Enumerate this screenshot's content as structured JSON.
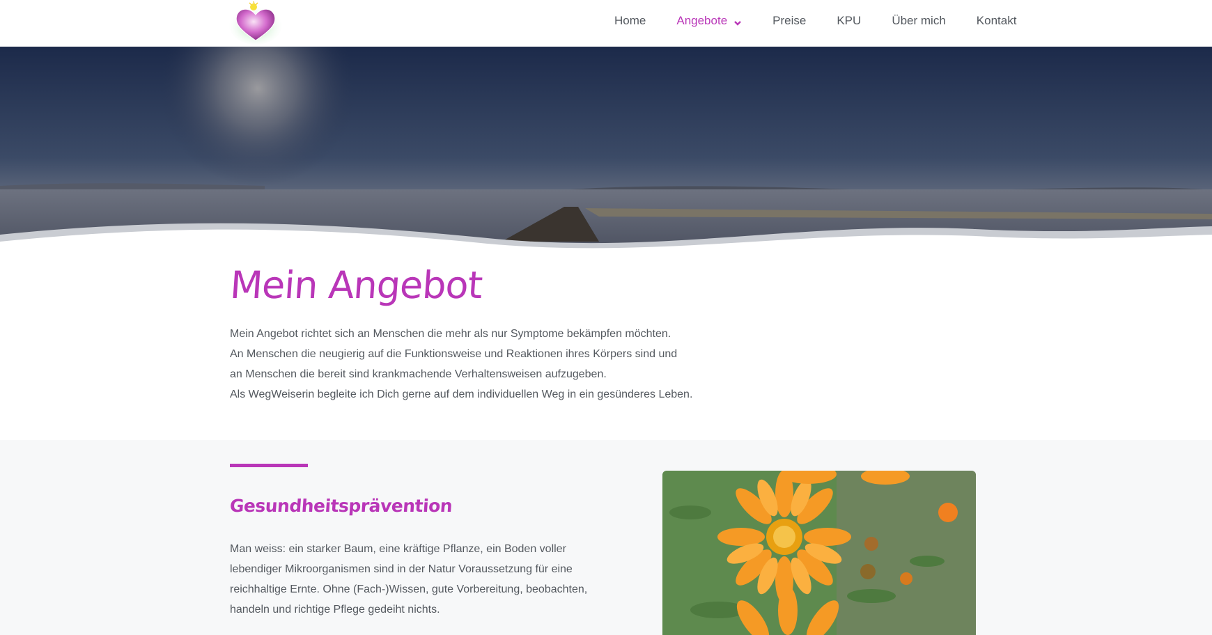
{
  "nav": {
    "items": [
      {
        "label": "Home"
      },
      {
        "label": "Angebote"
      },
      {
        "label": "Preise"
      },
      {
        "label": "KPU"
      },
      {
        "label": "Über mich"
      },
      {
        "label": "Kontakt"
      }
    ],
    "active_index": 1
  },
  "intro": {
    "title": "Mein Angebot",
    "lines": [
      "Mein Angebot richtet sich an Menschen die mehr als nur Symptome bekämpfen möchten.",
      "An Menschen die neugierig auf die Funktionsweise und Reaktionen ihres Körpers sind und",
      "an Menschen die bereit sind krankmachende Verhaltensweisen aufzugeben.",
      "Als WegWeiserin begleite ich Dich gerne auf dem individuellen Weg in ein gesünderes Leben."
    ]
  },
  "section": {
    "title": "Gesundheitsprävention",
    "lines": [
      "Man weiss: ein starker Baum, eine kräftige Pflanze, ein Boden voller",
      "lebendiger Mikroorganismen sind in der Natur Voraussetzung für eine",
      "reichhaltige Ernte. Ohne (Fach-)Wissen, gute Vorbereitung, beobachten,",
      "handeln und richtige Pflege gedeiht nichts."
    ]
  },
  "colors": {
    "accent": "#b936b8",
    "text": "#54595f",
    "section_bg": "#f7f8f9"
  },
  "icons": {
    "logo": "heart-logo-icon",
    "dropdown": "chevron-down-icon"
  }
}
